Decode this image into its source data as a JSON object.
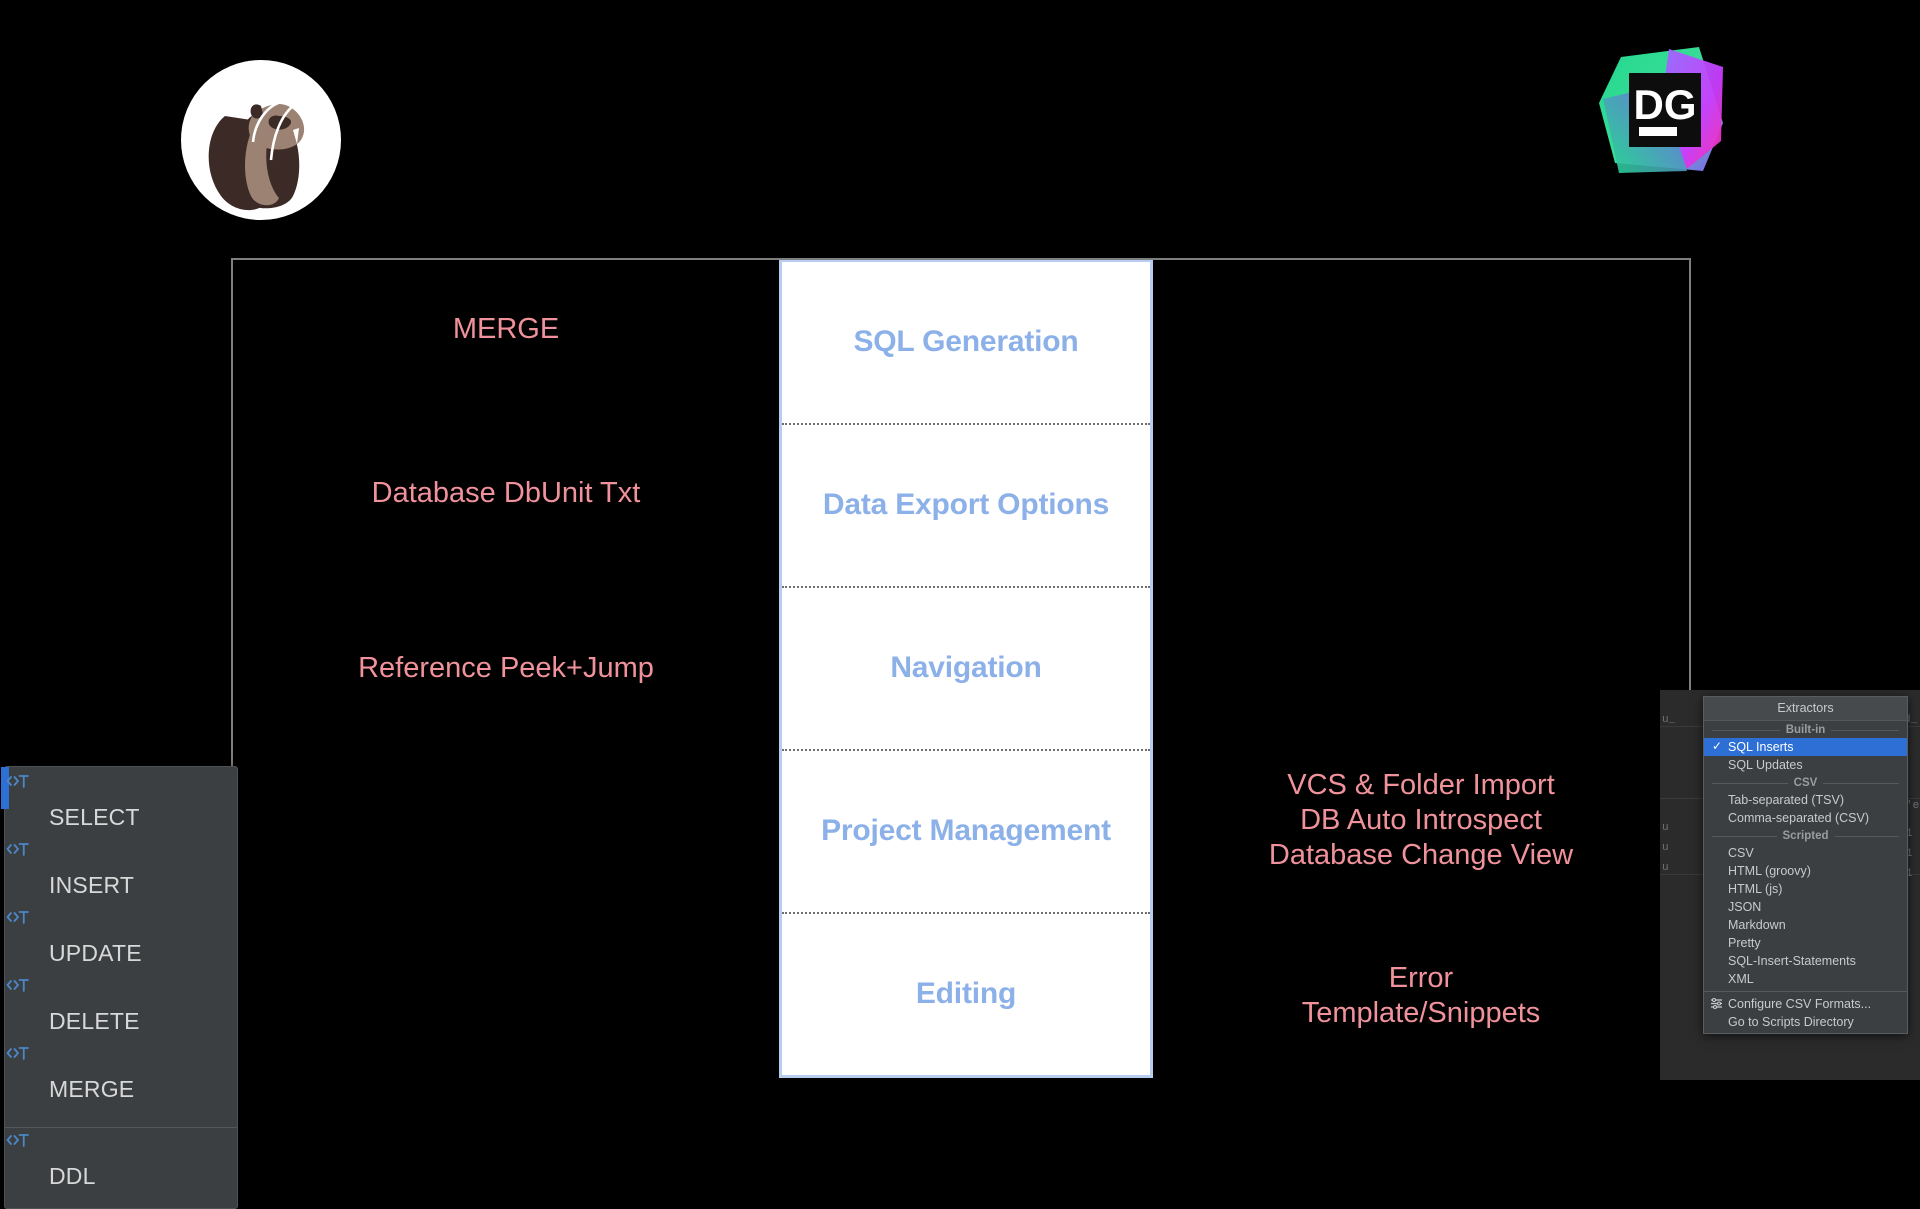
{
  "logos": {
    "left": {
      "name": "DBeaver",
      "icon": "beaver-logo"
    },
    "right": {
      "name": "DataGrip",
      "icon": "datagrip-logo",
      "text": "DG"
    }
  },
  "comparison": {
    "center_categories": [
      "SQL Generation",
      "Data Export Options",
      "Navigation",
      "Project Management",
      "Editing"
    ],
    "left_items": [
      "MERGE",
      "Database DbUnit Txt",
      "Reference Peek+Jump",
      "",
      ""
    ],
    "right_items": [
      "",
      "",
      "",
      "VCS & Folder Import\nDB Auto Introspect\nDatabase Change View",
      "Error\nTemplate/Snippets"
    ],
    "colors": {
      "center_text": "#8cb0e8",
      "side_text": "#f0929b",
      "frame_border": "#7f7f7f",
      "center_border": "#b6cdf0",
      "background": "#000000"
    }
  },
  "context_menu": {
    "items": [
      {
        "label": "SELECT",
        "icon": "sql-template-icon",
        "selected": true
      },
      {
        "label": "INSERT",
        "icon": "sql-template-icon",
        "selected": false
      },
      {
        "label": "UPDATE",
        "icon": "sql-template-icon",
        "selected": false
      },
      {
        "label": "DELETE",
        "icon": "sql-template-icon",
        "selected": false
      },
      {
        "label": "MERGE",
        "icon": "sql-template-icon",
        "selected": false
      }
    ],
    "items_after_separator": [
      {
        "label": "DDL",
        "icon": "sql-template-icon",
        "selected": false
      }
    ]
  },
  "extractors_popup": {
    "title": "Extractors",
    "groups": [
      {
        "name": "Built-in",
        "items": [
          {
            "label": "SQL Inserts",
            "checked": true
          },
          {
            "label": "SQL Updates",
            "checked": false
          }
        ]
      },
      {
        "name": "CSV",
        "items": [
          {
            "label": "Tab-separated (TSV)",
            "checked": false
          },
          {
            "label": "Comma-separated (CSV)",
            "checked": false
          }
        ]
      },
      {
        "name": "Scripted",
        "items": [
          {
            "label": "CSV",
            "checked": false
          },
          {
            "label": "HTML (groovy)",
            "checked": false
          },
          {
            "label": "HTML (js)",
            "checked": false
          },
          {
            "label": "JSON",
            "checked": false
          },
          {
            "label": "Markdown",
            "checked": false
          },
          {
            "label": "Pretty",
            "checked": false
          },
          {
            "label": "SQL-Insert-Statements",
            "checked": false
          },
          {
            "label": "XML",
            "checked": false
          }
        ]
      }
    ],
    "actions": [
      {
        "label": "Configure CSV Formats...",
        "icon": "sliders-icon"
      },
      {
        "label": "Go to Scripts Directory",
        "icon": ""
      }
    ],
    "checkmark": "✓",
    "highlight_color": "#2d6fd4"
  }
}
